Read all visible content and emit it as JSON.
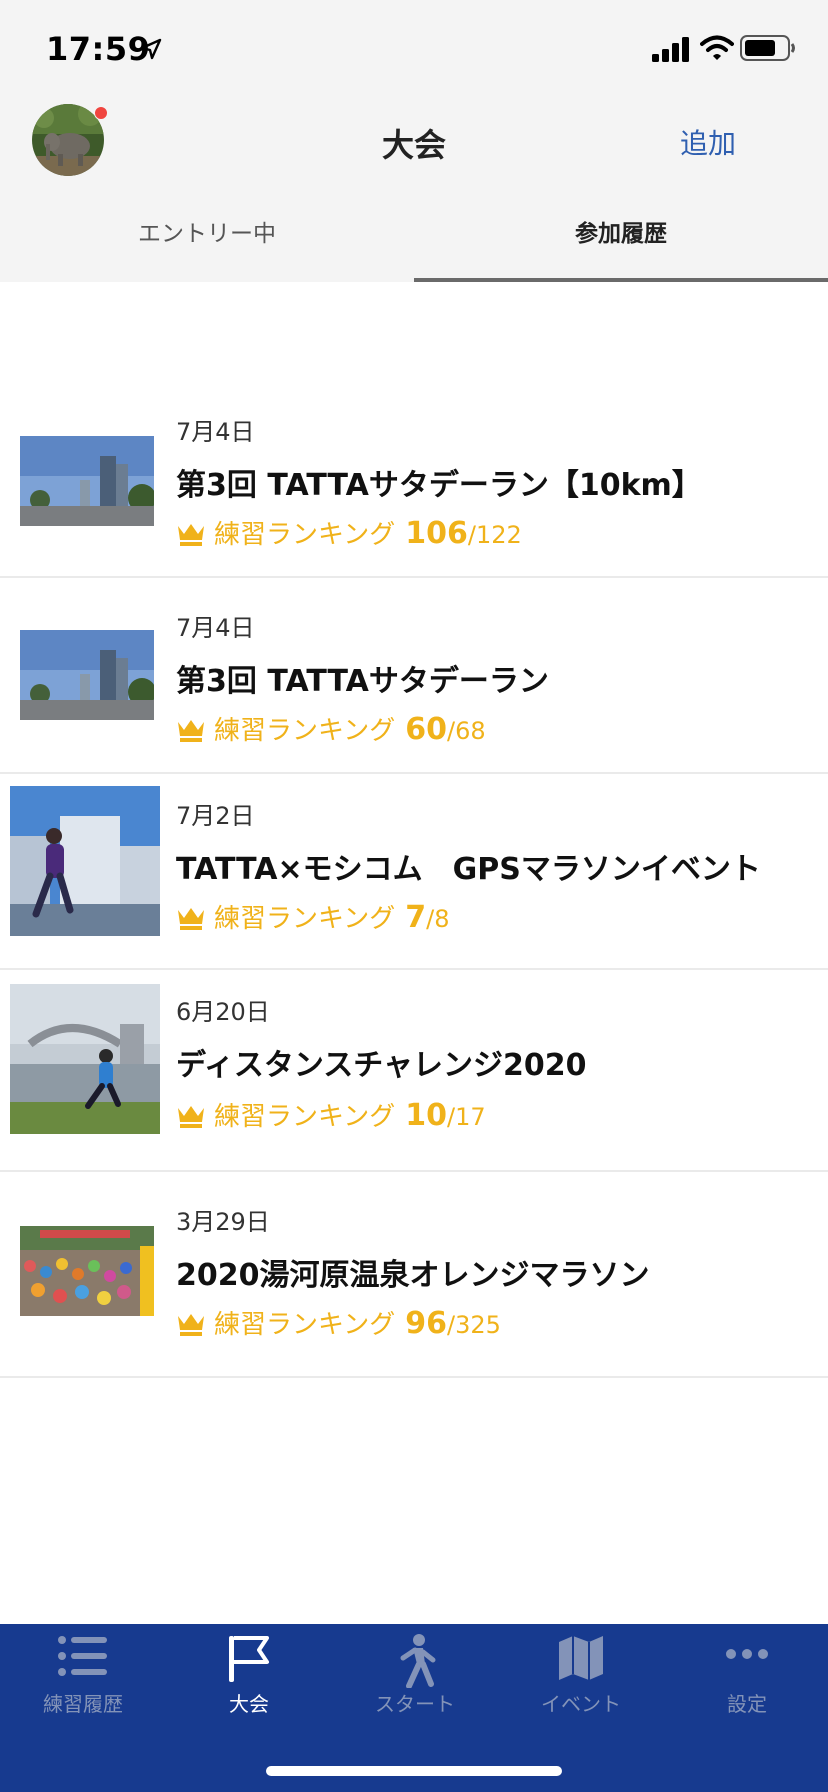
{
  "status_bar": {
    "time": "17:59"
  },
  "header": {
    "title": "大会",
    "add_label": "追加",
    "avatar_notification": true
  },
  "tabs": [
    {
      "label": "エントリー中",
      "active": false
    },
    {
      "label": "参加履歴",
      "active": true
    }
  ],
  "races": [
    {
      "date": "7月4日",
      "name": "第3回 TATTAサタデーラン【10km】",
      "rank_label": "練習ランキング",
      "rank": "106",
      "total": "/122",
      "thumb": "city-towers"
    },
    {
      "date": "7月4日",
      "name": "第3回 TATTAサタデーラン",
      "rank_label": "練習ランキング",
      "rank": "60",
      "total": "/68",
      "thumb": "city-towers"
    },
    {
      "date": "7月2日",
      "name": "TATTA×モシコム　GPSマラソンイベント",
      "rank_label": "練習ランキング",
      "rank": "7",
      "total": "/8",
      "thumb": "runner-city"
    },
    {
      "date": "6月20日",
      "name": "ディスタンスチャレンジ2020",
      "rank_label": "練習ランキング",
      "rank": "10",
      "total": "/17",
      "thumb": "runner-bridge"
    },
    {
      "date": "3月29日",
      "name": "2020湯河原温泉オレンジマラソン",
      "rank_label": "練習ランキング",
      "rank": "96",
      "total": "/325",
      "thumb": "marathon-crowd"
    }
  ],
  "tab_bar": [
    {
      "label": "練習履歴",
      "icon": "list-icon",
      "active": false
    },
    {
      "label": "大会",
      "icon": "flag-icon",
      "active": true
    },
    {
      "label": "スタート",
      "icon": "runner-icon",
      "active": false
    },
    {
      "label": "イベント",
      "icon": "map-icon",
      "active": false
    },
    {
      "label": "設定",
      "icon": "more-icon",
      "active": false
    }
  ],
  "colors": {
    "accent_blue": "#2f5fb0",
    "tab_bar_bg": "#173a8f",
    "rank_gold": "#f0b21a",
    "notification_red": "#f0453f"
  }
}
